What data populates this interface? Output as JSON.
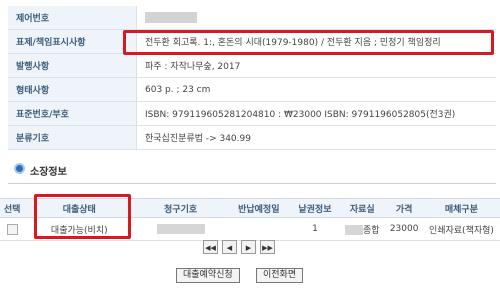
{
  "record": {
    "rows": [
      {
        "label": "제어번호",
        "value": ""
      },
      {
        "label": "표제/책임표시사항",
        "value": "전두환 회고록. 1:, 혼돈의 시대(1979-1980) / 전두환 지음 ; 민정기 책임정리"
      },
      {
        "label": "발행사항",
        "value": "파주 : 자작나무숲, 2017"
      },
      {
        "label": "형태사항",
        "value": "603 p. ; 23 cm"
      },
      {
        "label": "표준번호/부호",
        "value": "ISBN: 9791196052812048­10 : ₩23000 ISBN: 9791196052805(전3권)"
      },
      {
        "label": "분류기호",
        "value": "한국십진분류법 -> 340.99"
      }
    ]
  },
  "holdings": {
    "section_title": "소장정보",
    "columns": [
      "선택",
      "대출상태",
      "청구기호",
      "반납예정일",
      "낱권정보",
      "자료실",
      "가격",
      "매체구분"
    ],
    "rows": [
      {
        "status": "대출가능(비치)",
        "call_number": "",
        "due_date": "",
        "volume": "1",
        "location": "종합",
        "price": "23000",
        "media": "인쇄자료(책자형)"
      }
    ]
  },
  "pager": {
    "first": "◀◀",
    "prev": "◀",
    "next": "▶",
    "last": "▶▶"
  },
  "actions": {
    "reserve": "대출예약신청",
    "back": "이전화면"
  },
  "colors": {
    "highlight": "#d71920",
    "label_bg": "#eef4f9",
    "label_text": "#3d5d7c"
  }
}
